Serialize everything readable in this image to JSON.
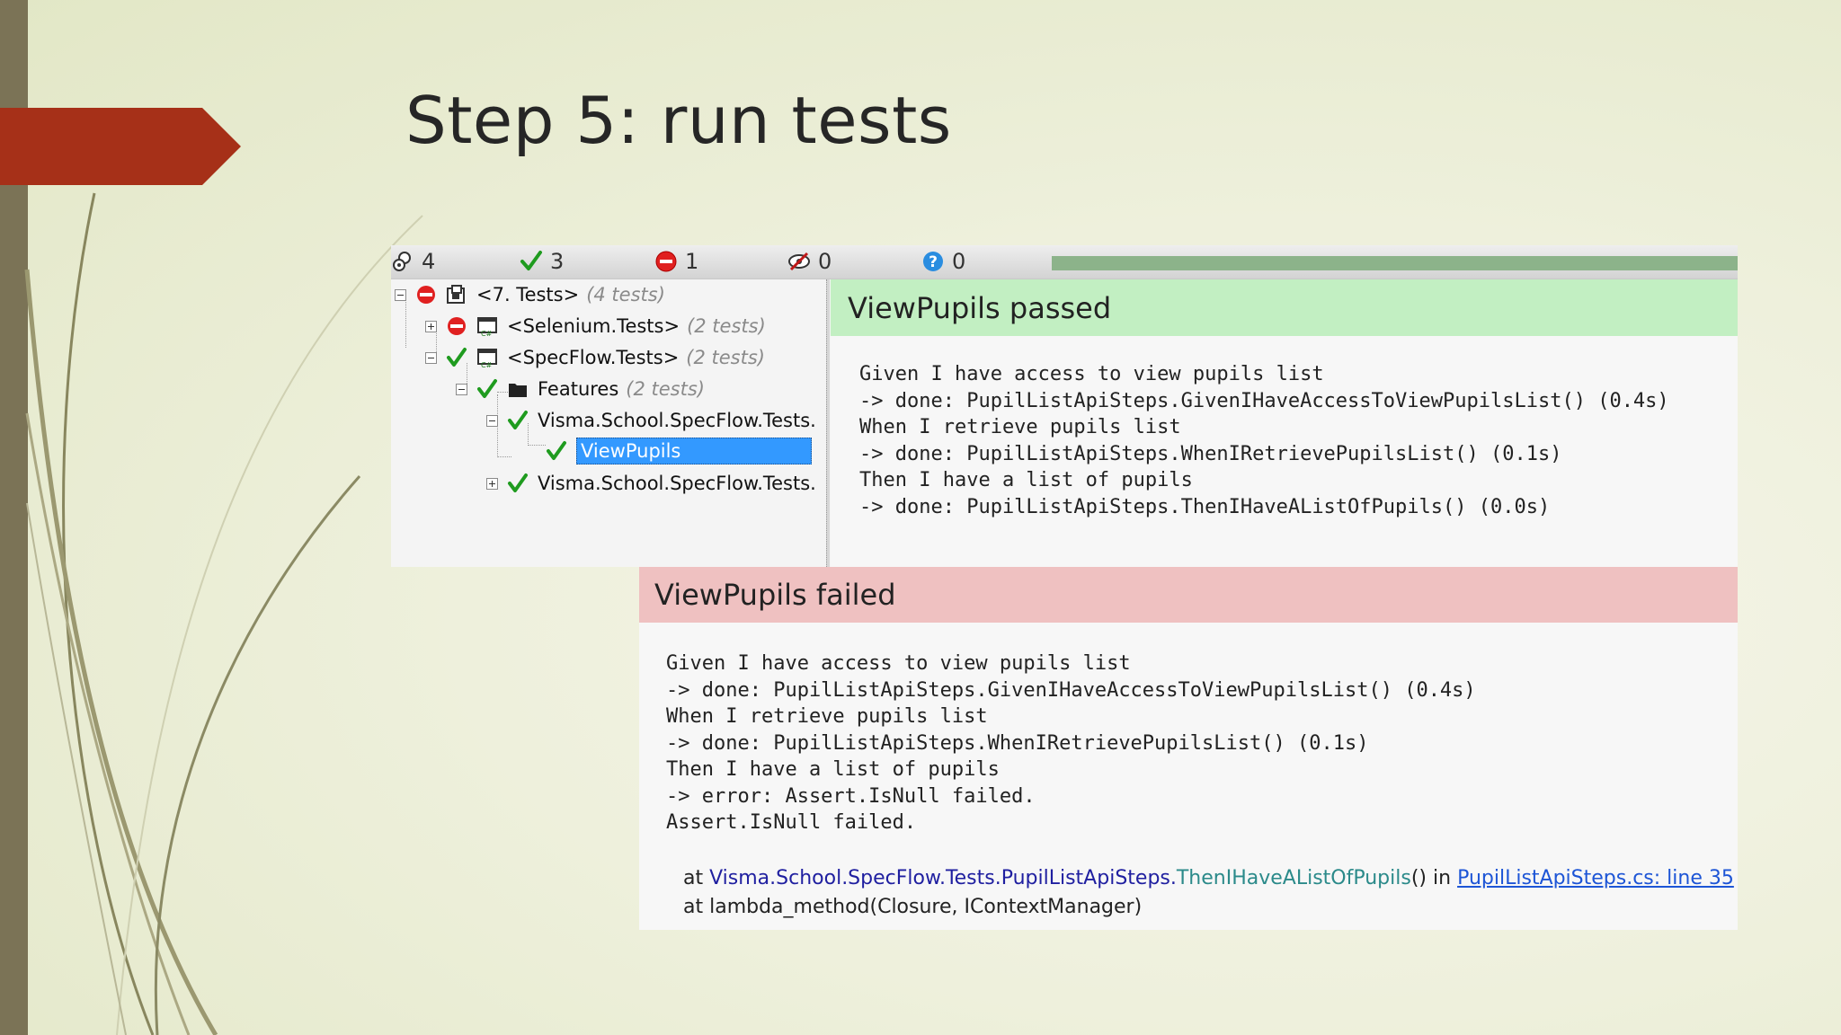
{
  "slide": {
    "title": "Step 5: run tests",
    "accent_color": "#a63018",
    "sidebar_color": "#7b7356"
  },
  "toolbar": {
    "total": {
      "icon": "total-tests-icon",
      "value": "4"
    },
    "passed": {
      "icon": "check-icon",
      "value": "3"
    },
    "failed": {
      "icon": "stop-icon",
      "value": "1"
    },
    "ignored": {
      "icon": "ignored-icon",
      "value": "0"
    },
    "inconclusive": {
      "icon": "question-icon",
      "value": "0"
    },
    "progress_fraction": 1.0,
    "progress_color": "#8cb38a"
  },
  "tree": {
    "root": {
      "label": "<7. Tests>",
      "count": "(4 tests)",
      "status": "failed"
    },
    "selenium": {
      "label": "<Selenium.Tests>",
      "count": "(2 tests)",
      "status": "failed"
    },
    "specflow": {
      "label": "<SpecFlow.Tests>",
      "count": "(2 tests)",
      "status": "passed"
    },
    "features": {
      "label": "Features",
      "count": "(2 tests)",
      "status": "passed"
    },
    "fixture1": {
      "label": "Visma.School.SpecFlow.Tests.",
      "status": "passed"
    },
    "viewpupils": {
      "label": "ViewPupils",
      "status": "passed",
      "selected": true
    },
    "fixture2": {
      "label": "Visma.School.SpecFlow.Tests.",
      "status": "passed"
    }
  },
  "passed_result": {
    "header": "ViewPupils passed",
    "lines": [
      "Given I have access to view pupils list",
      "-> done: PupilListApiSteps.GivenIHaveAccessToViewPupilsList() (0.4s)",
      "When I retrieve pupils list",
      "-> done: PupilListApiSteps.WhenIRetrievePupilsList() (0.1s)",
      "Then I have a list of pupils",
      "-> done: PupilListApiSteps.ThenIHaveAListOfPupils() (0.0s)"
    ]
  },
  "failed_result": {
    "header": "ViewPupils failed",
    "lines": [
      "Given I have access to view pupils list",
      "-> done: PupilListApiSteps.GivenIHaveAccessToViewPupilsList() (0.4s)",
      "When I retrieve pupils list",
      "-> done: PupilListApiSteps.WhenIRetrievePupilsList() (0.1s)",
      "Then I have a list of pupils",
      "-> error: Assert.IsNull failed.",
      "Assert.IsNull failed."
    ],
    "stack": {
      "at_prefix": "at ",
      "namespace": "Visma.School.SpecFlow.Tests.PupilListApiSteps.",
      "method": "ThenIHaveAListOfPupils",
      "suffix": "() in ",
      "source_link": "PupilListApiSteps.cs: line 35",
      "line2": "at lambda_method(Closure, IContextManager)"
    }
  }
}
